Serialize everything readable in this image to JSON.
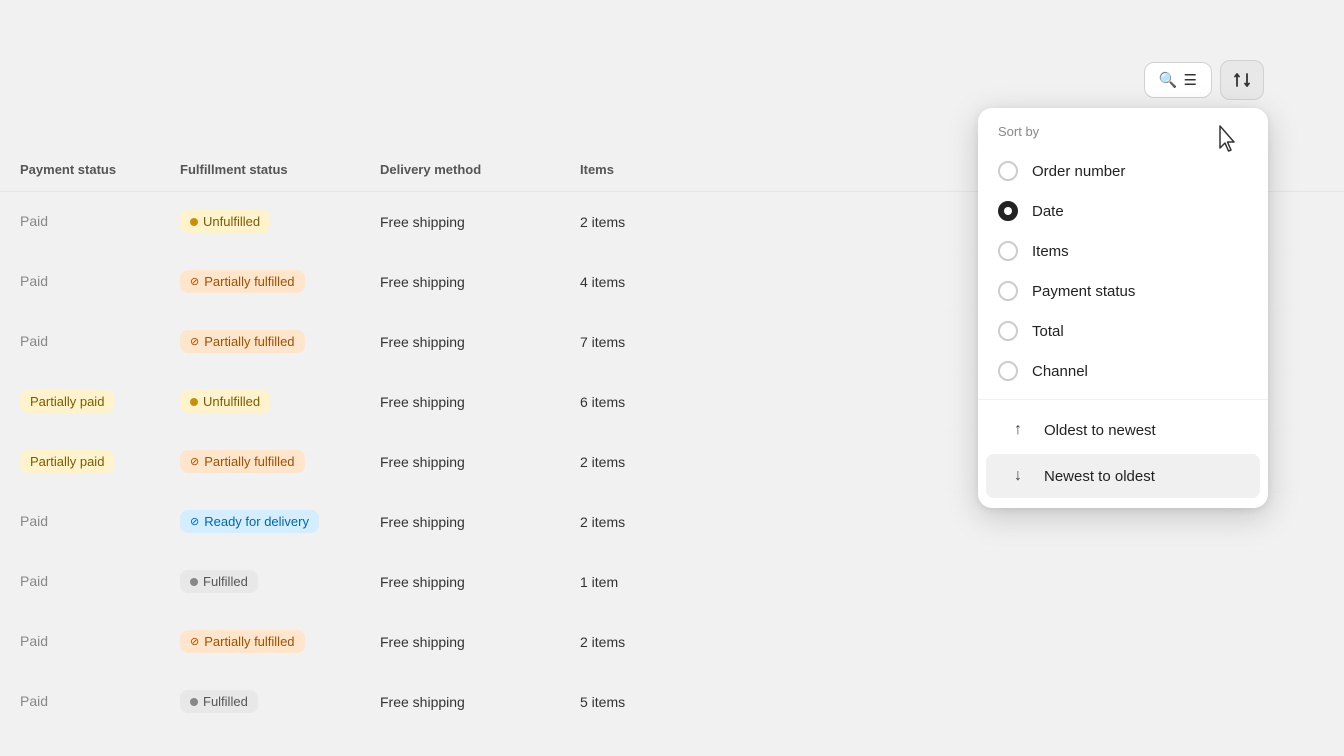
{
  "toolbar": {
    "search_filter_label": "Search & Filter",
    "sort_label": "Sort",
    "sort_icon": "↕"
  },
  "table": {
    "headers": [
      "Payment status",
      "Fulfillment status",
      "Delivery method",
      "Items",
      ""
    ],
    "rows": [
      {
        "payment": "Paid",
        "fulfillment": "Unfulfilled",
        "fulfillment_type": "unfulfilled",
        "delivery": "Free shipping",
        "items": "2 items"
      },
      {
        "payment": "Paid",
        "fulfillment": "Partially fulfilled",
        "fulfillment_type": "partial",
        "delivery": "Free shipping",
        "items": "4 items"
      },
      {
        "payment": "Paid",
        "fulfillment": "Partially fulfilled",
        "fulfillment_type": "partial",
        "delivery": "Free shipping",
        "items": "7 items"
      },
      {
        "payment": "Partially paid",
        "fulfillment": "Unfulfilled",
        "fulfillment_type": "unfulfilled",
        "delivery": "Free shipping",
        "items": "6 items"
      },
      {
        "payment": "Partially paid",
        "fulfillment": "Partially fulfilled",
        "fulfillment_type": "partial",
        "delivery": "Free shipping",
        "items": "2 items"
      },
      {
        "payment": "Paid",
        "fulfillment": "Ready for delivery",
        "fulfillment_type": "ready",
        "delivery": "Free shipping",
        "items": "2 items"
      },
      {
        "payment": "Paid",
        "fulfillment": "Fulfilled",
        "fulfillment_type": "fulfilled",
        "delivery": "Free shipping",
        "items": "1 item"
      },
      {
        "payment": "Paid",
        "fulfillment": "Partially fulfilled",
        "fulfillment_type": "partial",
        "delivery": "Free shipping",
        "items": "2 items"
      },
      {
        "payment": "Paid",
        "fulfillment": "Fulfilled",
        "fulfillment_type": "fulfilled",
        "delivery": "Free shipping",
        "items": "5 items"
      }
    ]
  },
  "sort_dropdown": {
    "title": "Sort by",
    "options": [
      {
        "id": "order_number",
        "label": "Order number",
        "selected": false
      },
      {
        "id": "date",
        "label": "Date",
        "selected": true
      },
      {
        "id": "items",
        "label": "Items",
        "selected": false
      },
      {
        "id": "payment_status",
        "label": "Payment status",
        "selected": false
      },
      {
        "id": "total",
        "label": "Total",
        "selected": false
      },
      {
        "id": "channel",
        "label": "Channel",
        "selected": false
      }
    ],
    "directions": [
      {
        "id": "oldest",
        "label": "Oldest to newest",
        "arrow": "↑",
        "active": false
      },
      {
        "id": "newest",
        "label": "Newest to oldest",
        "arrow": "↓",
        "active": true
      }
    ]
  }
}
